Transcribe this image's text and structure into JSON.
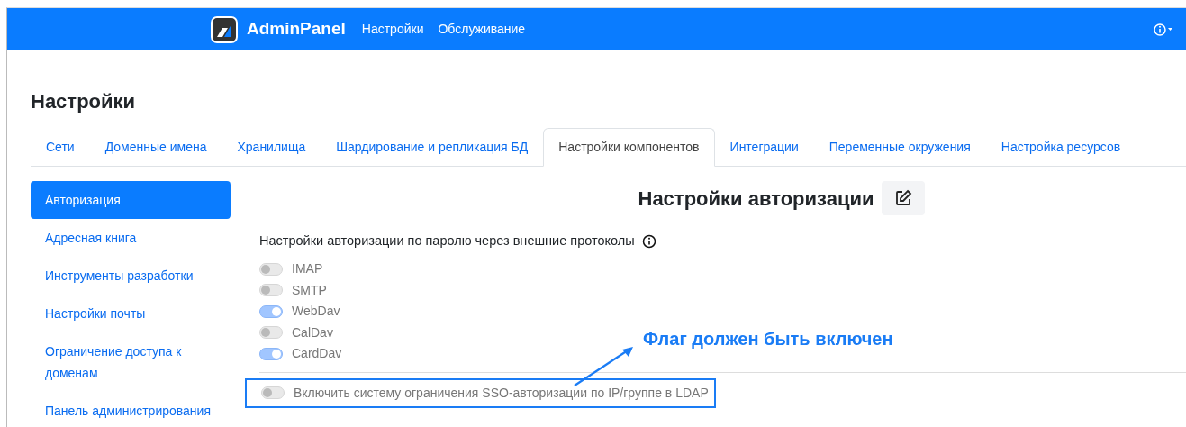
{
  "navbar": {
    "brand": "AdminPanel",
    "links": [
      "Настройки",
      "Обслуживание"
    ]
  },
  "page_title": "Настройки",
  "tabs": [
    {
      "label": "Сети",
      "selected": false
    },
    {
      "label": "Доменные имена",
      "selected": false
    },
    {
      "label": "Хранилища",
      "selected": false
    },
    {
      "label": "Шардирование и репликация БД",
      "selected": false
    },
    {
      "label": "Настройки компонентов",
      "selected": true
    },
    {
      "label": "Интеграции",
      "selected": false
    },
    {
      "label": "Переменные окружения",
      "selected": false
    },
    {
      "label": "Настройка ресурсов",
      "selected": false
    }
  ],
  "sidebar": {
    "items": [
      {
        "label": "Авторизация",
        "selected": true
      },
      {
        "label": "Адресная книга",
        "selected": false
      },
      {
        "label": "Инструменты разработки",
        "selected": false
      },
      {
        "label": "Настройки почты",
        "selected": false
      },
      {
        "label": "Ограничение доступа к доменам",
        "selected": false
      },
      {
        "label": "Панель администрирования",
        "selected": false
      }
    ]
  },
  "section": {
    "title": "Настройки авторизации",
    "group_label": "Настройки авторизации по паролю через внешние протоколы",
    "protocols": [
      {
        "label": "IMAP",
        "on": false,
        "disabled": true
      },
      {
        "label": "SMTP",
        "on": false,
        "disabled": true
      },
      {
        "label": "WebDav",
        "on": true,
        "disabled": true
      },
      {
        "label": "CalDav",
        "on": false,
        "disabled": true
      },
      {
        "label": "CardDav",
        "on": true,
        "disabled": true
      }
    ],
    "sso_restriction": {
      "label": "Включить систему ограничения SSO-авторизации по IP/группе в LDAP",
      "on": false,
      "disabled": true,
      "highlighted": true
    }
  },
  "annotation": {
    "text": "Флаг должен быть включен"
  }
}
